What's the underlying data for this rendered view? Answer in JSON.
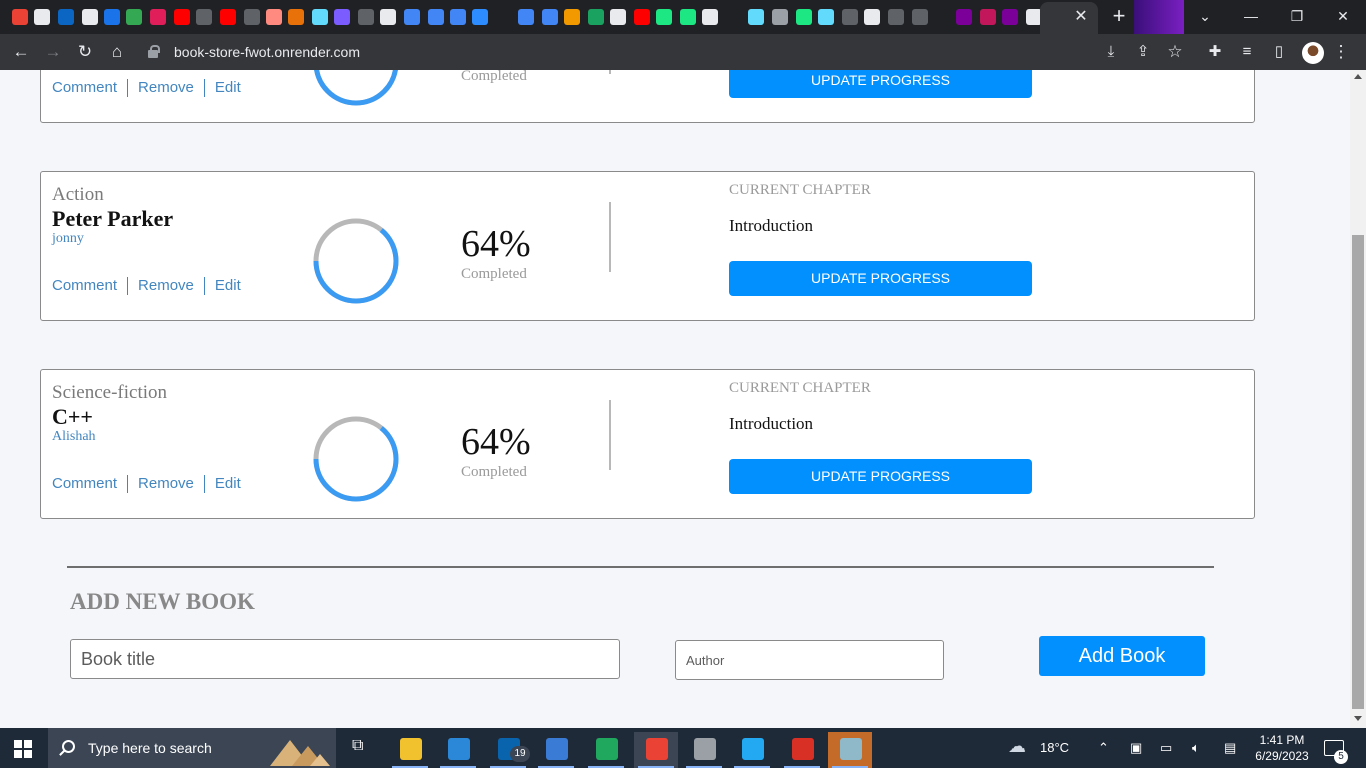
{
  "browser": {
    "url": "book-store-fwot.onrender.com"
  },
  "books": [
    {
      "genre": "",
      "title": "",
      "author": "",
      "progress_percent": 64,
      "progress_label": "",
      "completed_label": "Completed",
      "chapter_label": "",
      "chapter_value": "",
      "actions": [
        "Comment",
        "Remove",
        "Edit"
      ],
      "update_label": "UPDATE PROGRESS"
    },
    {
      "genre": "Action",
      "title": "Peter Parker",
      "author": "jonny",
      "progress_percent": 64,
      "progress_label": "64%",
      "completed_label": "Completed",
      "chapter_label": "CURRENT CHAPTER",
      "chapter_value": "Introduction",
      "actions": [
        "Comment",
        "Remove",
        "Edit"
      ],
      "update_label": "UPDATE PROGRESS"
    },
    {
      "genre": "Science-fiction",
      "title": "C++",
      "author": "Alishah",
      "progress_percent": 64,
      "progress_label": "64%",
      "completed_label": "Completed",
      "chapter_label": "CURRENT CHAPTER",
      "chapter_value": "Introduction",
      "actions": [
        "Comment",
        "Remove",
        "Edit"
      ],
      "update_label": "UPDATE PROGRESS"
    }
  ],
  "add_form": {
    "heading": "ADD NEW BOOK",
    "title_placeholder": "Book title",
    "author_placeholder": "Author",
    "submit_label": "Add Book"
  },
  "taskbar": {
    "search_placeholder": "Type here to search",
    "mail_badge": "19",
    "weather": "18°C",
    "time": "1:41 PM",
    "date": "6/29/2023",
    "notifications": "5"
  },
  "colors": {
    "accent": "#0290ff",
    "link": "#4386bf",
    "ring": "#3b9bf2",
    "ring_track": "#b8b8b8"
  }
}
